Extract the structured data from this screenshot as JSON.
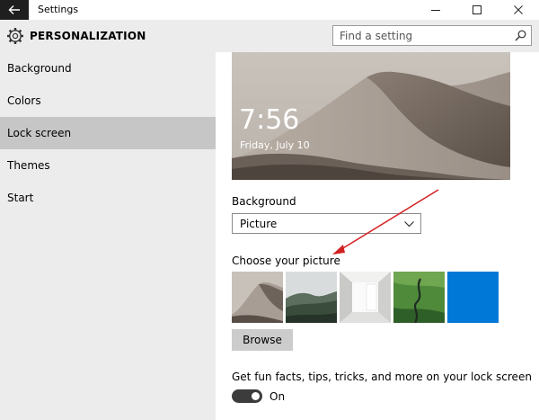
{
  "window": {
    "title": "Settings",
    "back_icon": "back-arrow-icon",
    "minimize_icon": "minimize-icon",
    "maximize_icon": "maximize-icon",
    "close_icon": "close-icon"
  },
  "header": {
    "icon": "gear-icon",
    "title": "PERSONALIZATION",
    "search_placeholder": "Find a setting",
    "search_icon": "search-icon"
  },
  "sidebar": {
    "items": [
      {
        "label": "Background",
        "selected": false
      },
      {
        "label": "Colors",
        "selected": false
      },
      {
        "label": "Lock screen",
        "selected": true
      },
      {
        "label": "Themes",
        "selected": false
      },
      {
        "label": "Start",
        "selected": false
      }
    ]
  },
  "preview": {
    "time": "7:56",
    "date": "Friday, July 10"
  },
  "background_setting": {
    "label": "Background",
    "selected_value": "Picture"
  },
  "picture_chooser": {
    "label": "Choose your picture",
    "thumbnails": [
      "desert-dunes",
      "misty-forest",
      "white-room",
      "green-valley-river",
      "solid-blue"
    ],
    "browse_label": "Browse"
  },
  "fun_facts": {
    "label": "Get fun facts, tips, tricks, and more on your lock screen",
    "state_label": "On",
    "enabled": true
  },
  "colors": {
    "accent": "#0078d7",
    "annotation_arrow": "#d42020",
    "selected_nav": "#c6c6c6",
    "sidebar_bg": "#ececec"
  }
}
